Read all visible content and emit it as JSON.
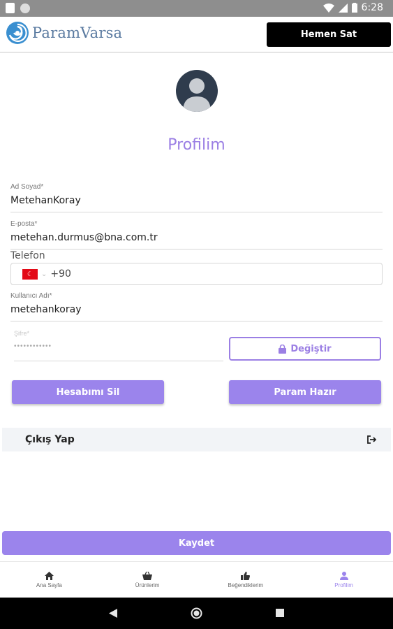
{
  "status_bar": {
    "time": "6:28"
  },
  "app": {
    "logo_text": "ParamVarsa",
    "sell_button": "Hemen Sat"
  },
  "profile": {
    "title": "Profilim"
  },
  "form": {
    "full_name": {
      "label": "Ad Soyad*",
      "value": "MetehanKoray"
    },
    "email": {
      "label": "E-posta*",
      "value": "metehan.durmus@bna.com.tr"
    },
    "phone": {
      "label": "Telefon",
      "country_code": "+90"
    },
    "username": {
      "label": "Kullanıcı Adı*",
      "value": "metehankoray"
    },
    "password": {
      "label": "Şifre*",
      "value": "••••••••••••"
    },
    "change_button": "Değiştir"
  },
  "actions": {
    "delete_account": "Hesabımı Sil",
    "param_hazir": "Param Hazır",
    "logout": "Çıkış Yap",
    "save": "Kaydet"
  },
  "bottom_nav": [
    {
      "label": "Ana Sayfa",
      "icon": "home-icon"
    },
    {
      "label": "Ürünlerim",
      "icon": "basket-icon"
    },
    {
      "label": "Beğendiklerim",
      "icon": "thumbs-up-icon"
    },
    {
      "label": "Profilim",
      "icon": "person-icon",
      "active": true
    }
  ],
  "colors": {
    "accent": "#9b84ec",
    "title": "#9b7fe4",
    "avatar": "#2f3c4d"
  }
}
